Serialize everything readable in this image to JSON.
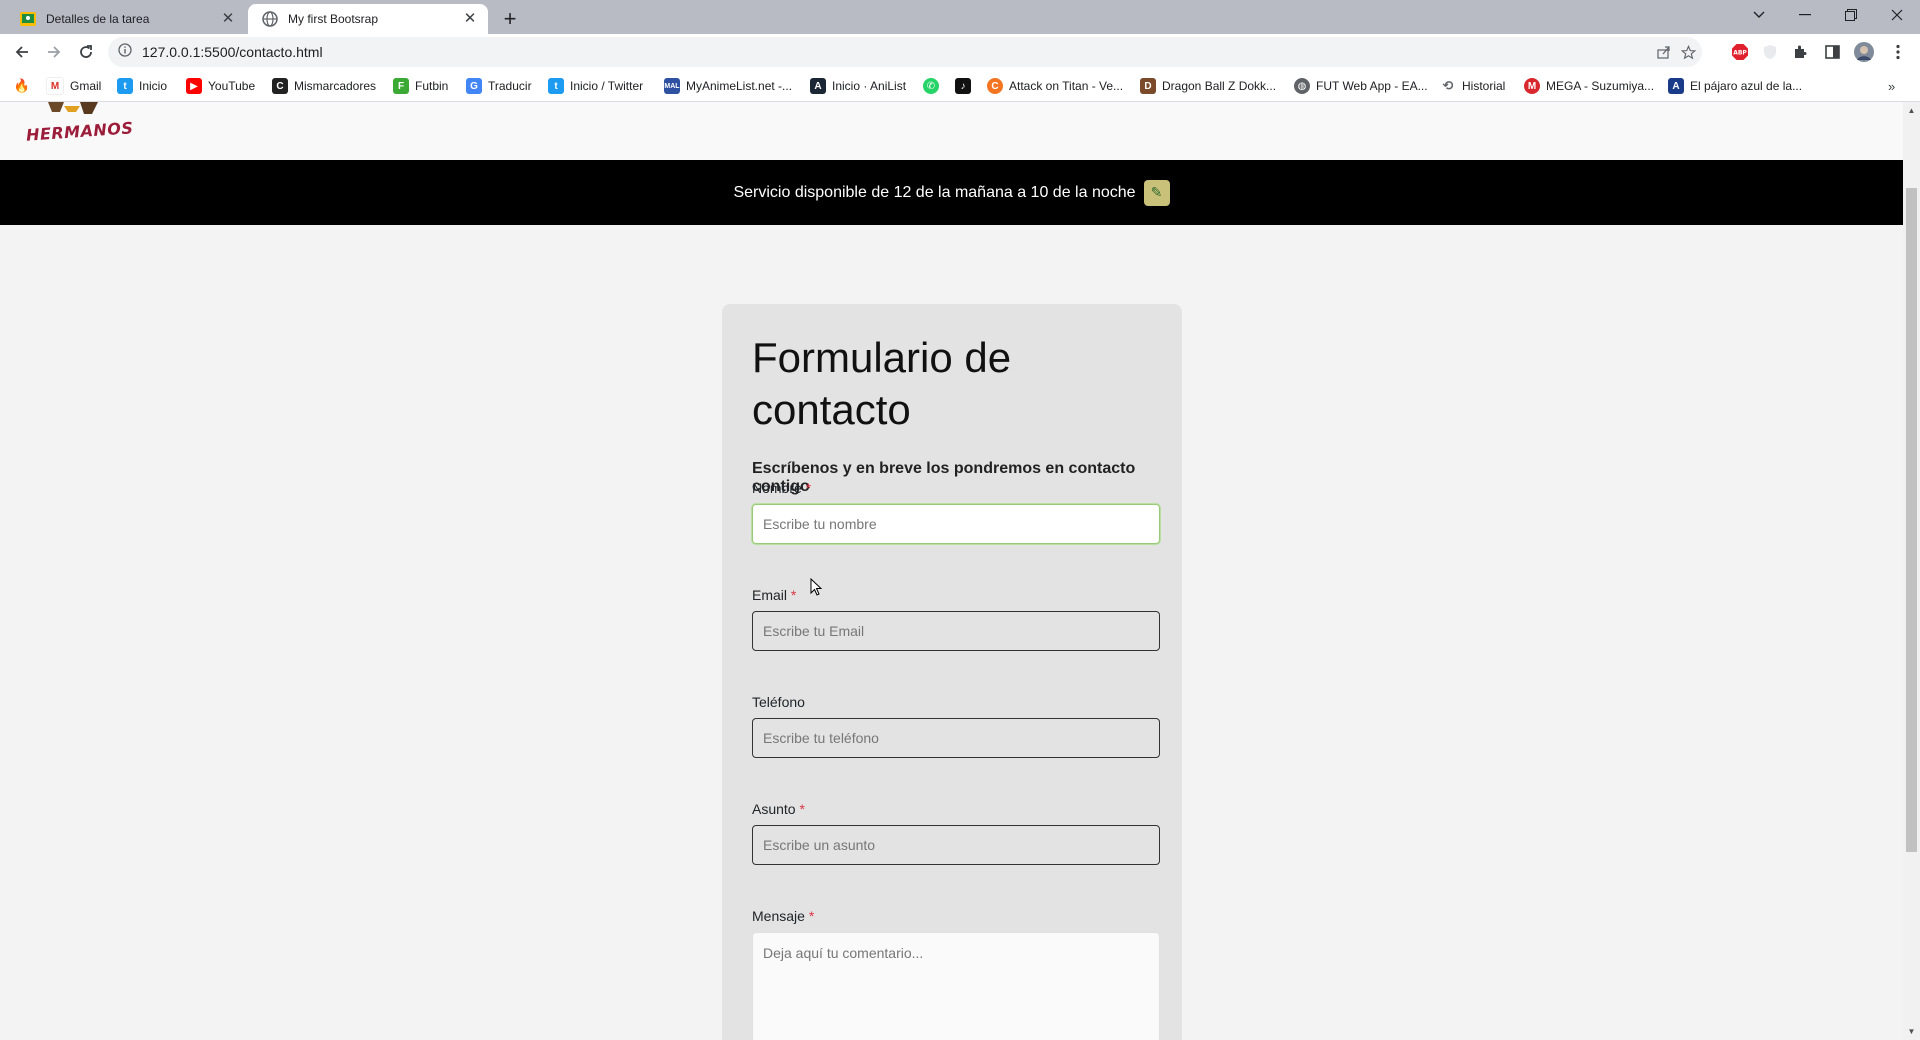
{
  "browser": {
    "tabs": [
      {
        "title": "Detalles de la tarea",
        "active": false
      },
      {
        "title": "My first Bootsrap",
        "active": true
      }
    ],
    "url": "127.0.0.1:5500/contacto.html",
    "bookmarks": [
      {
        "label": "Gmail",
        "icon": "gmail-icon",
        "color": "#d93025"
      },
      {
        "label": "Inicio",
        "icon": "twitter-icon",
        "color": "#1d9bf0"
      },
      {
        "label": "YouTube",
        "icon": "youtube-icon",
        "color": "#ff0000"
      },
      {
        "label": "Mismarcadores",
        "icon": "mismarcadores-icon",
        "color": "#222222"
      },
      {
        "label": "Futbin",
        "icon": "futbin-icon",
        "color": "#3aaa35"
      },
      {
        "label": "Traducir",
        "icon": "translate-icon",
        "color": "#4285f4"
      },
      {
        "label": "Inicio / Twitter",
        "icon": "twitter-icon",
        "color": "#1d9bf0"
      },
      {
        "label": "MyAnimeList.net -...",
        "icon": "myanimelist-icon",
        "color": "#2e51a2"
      },
      {
        "label": "Inicio · AniList",
        "icon": "anilist-icon",
        "color": "#1b2635"
      },
      {
        "label": "",
        "icon": "whatsapp-icon",
        "color": "#25d366"
      },
      {
        "label": "",
        "icon": "tiktok-icon",
        "color": "#111111"
      },
      {
        "label": "Attack on Titan - Ve...",
        "icon": "crunchyroll-icon",
        "color": "#f47521"
      },
      {
        "label": "Dragon Ball Z Dokk...",
        "icon": "dokkan-icon",
        "color": "#7a4a2a"
      },
      {
        "label": "FUT Web App - EA...",
        "icon": "globe-icon",
        "color": "#5f6368"
      },
      {
        "label": "Historial",
        "icon": "history-icon",
        "color": "#5f6368"
      },
      {
        "label": "MEGA - Suzumiya...",
        "icon": "mega-icon",
        "color": "#d9272e"
      },
      {
        "label": "El pájaro azul de la...",
        "icon": "bookmark-a-icon",
        "color": "#1a3a8a"
      }
    ]
  },
  "page": {
    "logo_text": "HERMANOS",
    "banner_text": "Servicio disponible de 12 de la mañana a 10 de la noche",
    "form": {
      "title": "Formulario de contacto",
      "subtitle": "Escríbenos y en breve los pondremos en contacto contigo",
      "required_mark": "*",
      "fields": [
        {
          "label": "Nombre",
          "required": true,
          "placeholder": "Escribe tu nombre",
          "focused": true
        },
        {
          "label": "Email",
          "required": true,
          "placeholder": "Escribe tu Email"
        },
        {
          "label": "Teléfono",
          "required": false,
          "placeholder": "Escribe tu teléfono"
        },
        {
          "label": "Asunto",
          "required": true,
          "placeholder": "Escribe un asunto"
        },
        {
          "label": "Mensaje",
          "required": true,
          "placeholder": "Deja aquí tu comentario..."
        }
      ]
    }
  }
}
